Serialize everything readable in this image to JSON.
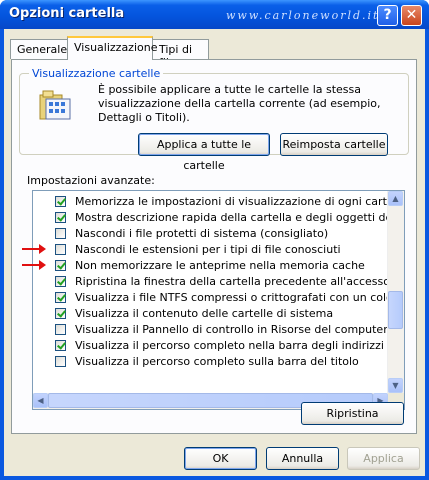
{
  "window": {
    "title": "Opzioni cartella",
    "watermark": "www.carloneworld.it",
    "help_label": "?",
    "close_label": "✕"
  },
  "tabs": [
    {
      "label": "Generale",
      "active": false
    },
    {
      "label": "Visualizzazione",
      "active": true
    },
    {
      "label": "Tipi di file",
      "active": false
    }
  ],
  "folder_views": {
    "group_title": "Visualizzazione cartelle",
    "icon": "folder-view-icon",
    "description": "È possibile applicare a tutte le cartelle la stessa visualizzazione della cartella corrente (ad esempio, Dettagli o Titoli).",
    "apply_all_label": "Applica a tutte le cartelle",
    "reset_folders_label": "Reimposta cartelle"
  },
  "advanced": {
    "label": "Impostazioni avanzate:",
    "items": [
      {
        "text": "Memorizza le impostazioni di visualizzazione di ogni cartella",
        "checked": true,
        "arrow": false
      },
      {
        "text": "Mostra descrizione rapida della cartella e degli oggetti del desktop",
        "checked": true,
        "arrow": false
      },
      {
        "text": "Nascondi i file protetti di sistema (consigliato)",
        "checked": false,
        "arrow": false
      },
      {
        "text": "Nascondi le estensioni per i tipi di file conosciuti",
        "checked": false,
        "arrow": true
      },
      {
        "text": "Non memorizzare le anteprime nella memoria cache",
        "checked": true,
        "arrow": true
      },
      {
        "text": "Ripristina la finestra della cartella precedente all'accesso",
        "checked": true,
        "arrow": false
      },
      {
        "text": "Visualizza i file NTFS compressi o crittografati con un colore diverso",
        "checked": true,
        "arrow": false
      },
      {
        "text": "Visualizza il contenuto delle cartelle di sistema",
        "checked": true,
        "arrow": false
      },
      {
        "text": "Visualizza il Pannello di controllo in Risorse del computer",
        "checked": false,
        "arrow": false
      },
      {
        "text": "Visualizza il percorso completo nella barra degli indirizzi",
        "checked": true,
        "arrow": false
      },
      {
        "text": "Visualizza il percorso completo sulla barra del titolo",
        "checked": false,
        "arrow": false
      }
    ],
    "restore_label": "Ripristina"
  },
  "footer": {
    "ok_label": "OK",
    "cancel_label": "Annulla",
    "apply_label": "Applica"
  }
}
